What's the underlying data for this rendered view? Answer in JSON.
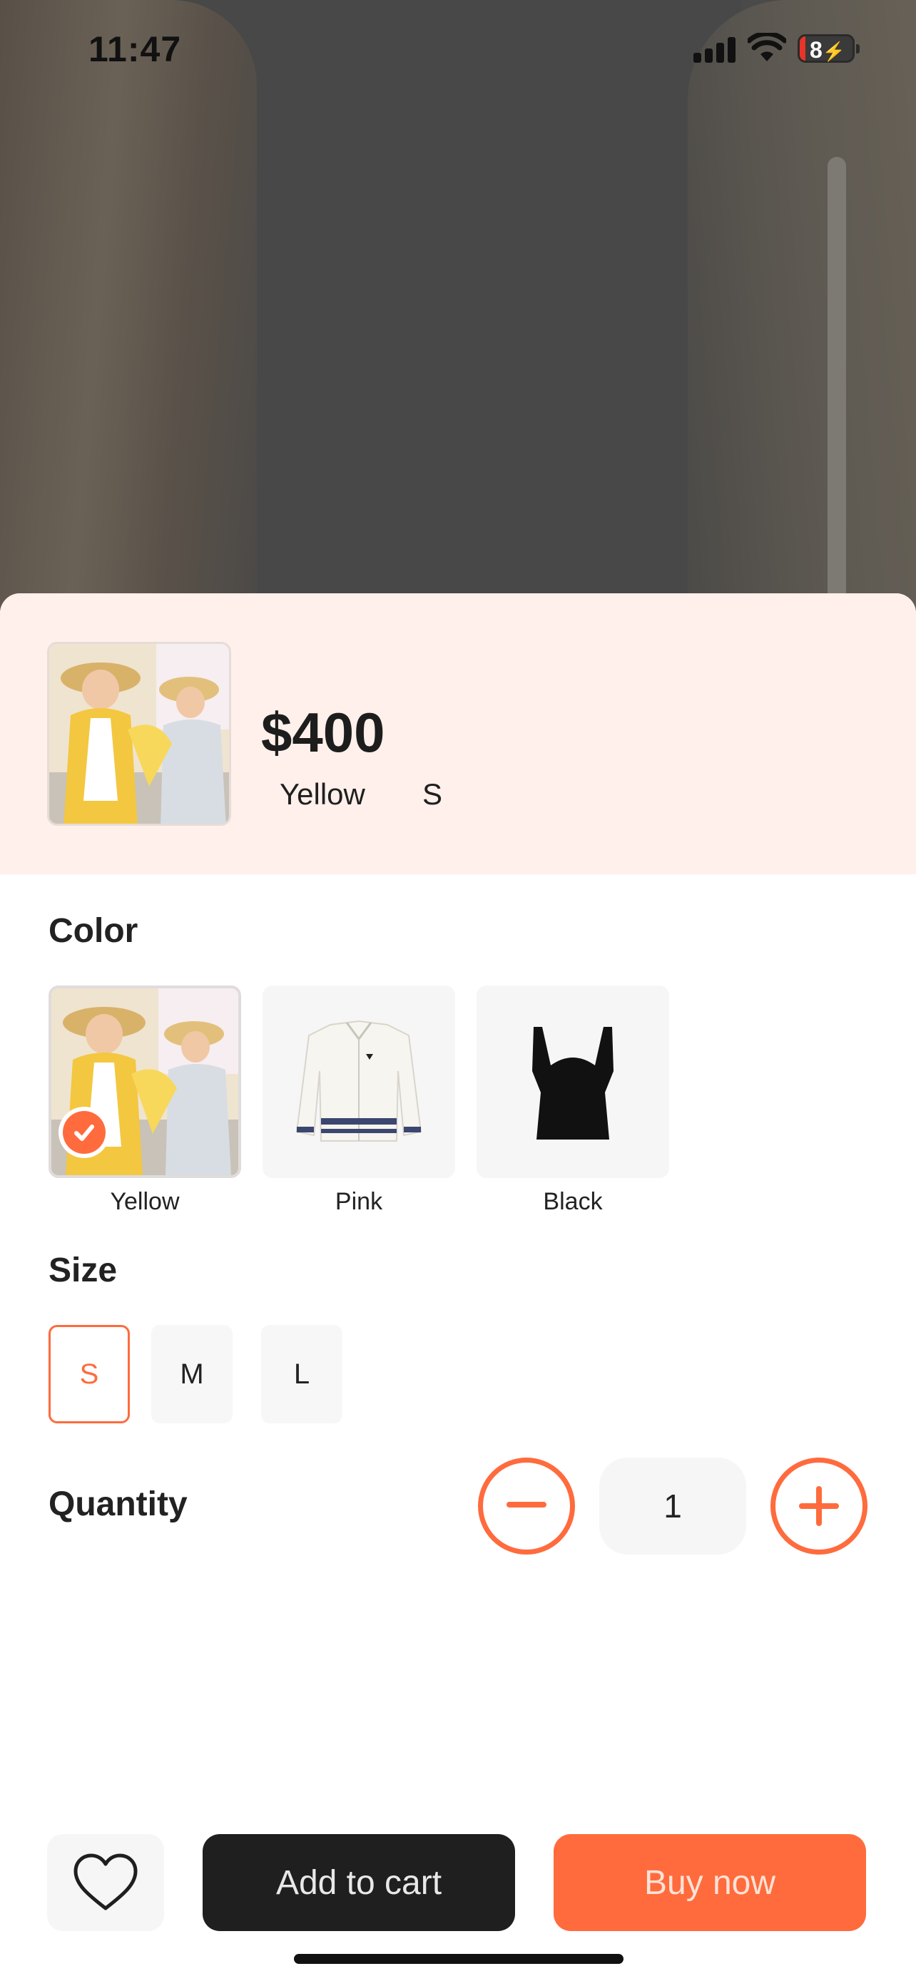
{
  "status_bar": {
    "time": "11:47",
    "battery": "8"
  },
  "summary": {
    "price": "$400",
    "selected_color": "Yellow",
    "selected_size": "S"
  },
  "color": {
    "title": "Color",
    "options": [
      {
        "label": "Yellow",
        "selected": true
      },
      {
        "label": "Pink",
        "selected": false
      },
      {
        "label": "Black",
        "selected": false
      }
    ]
  },
  "size": {
    "title": "Size",
    "options": [
      "S",
      "M",
      "L"
    ],
    "selected": "S"
  },
  "quantity": {
    "title": "Quantity",
    "value": "1"
  },
  "actions": {
    "add_to_cart": "Add to cart",
    "buy_now": "Buy now"
  },
  "colors": {
    "accent": "#ff6b3d",
    "dark": "#1f1f1f",
    "summary_bg": "#fff0eb"
  },
  "icons": [
    "signal-icon",
    "wifi-icon",
    "battery-icon",
    "check-icon",
    "minus-icon",
    "plus-icon",
    "heart-icon"
  ]
}
